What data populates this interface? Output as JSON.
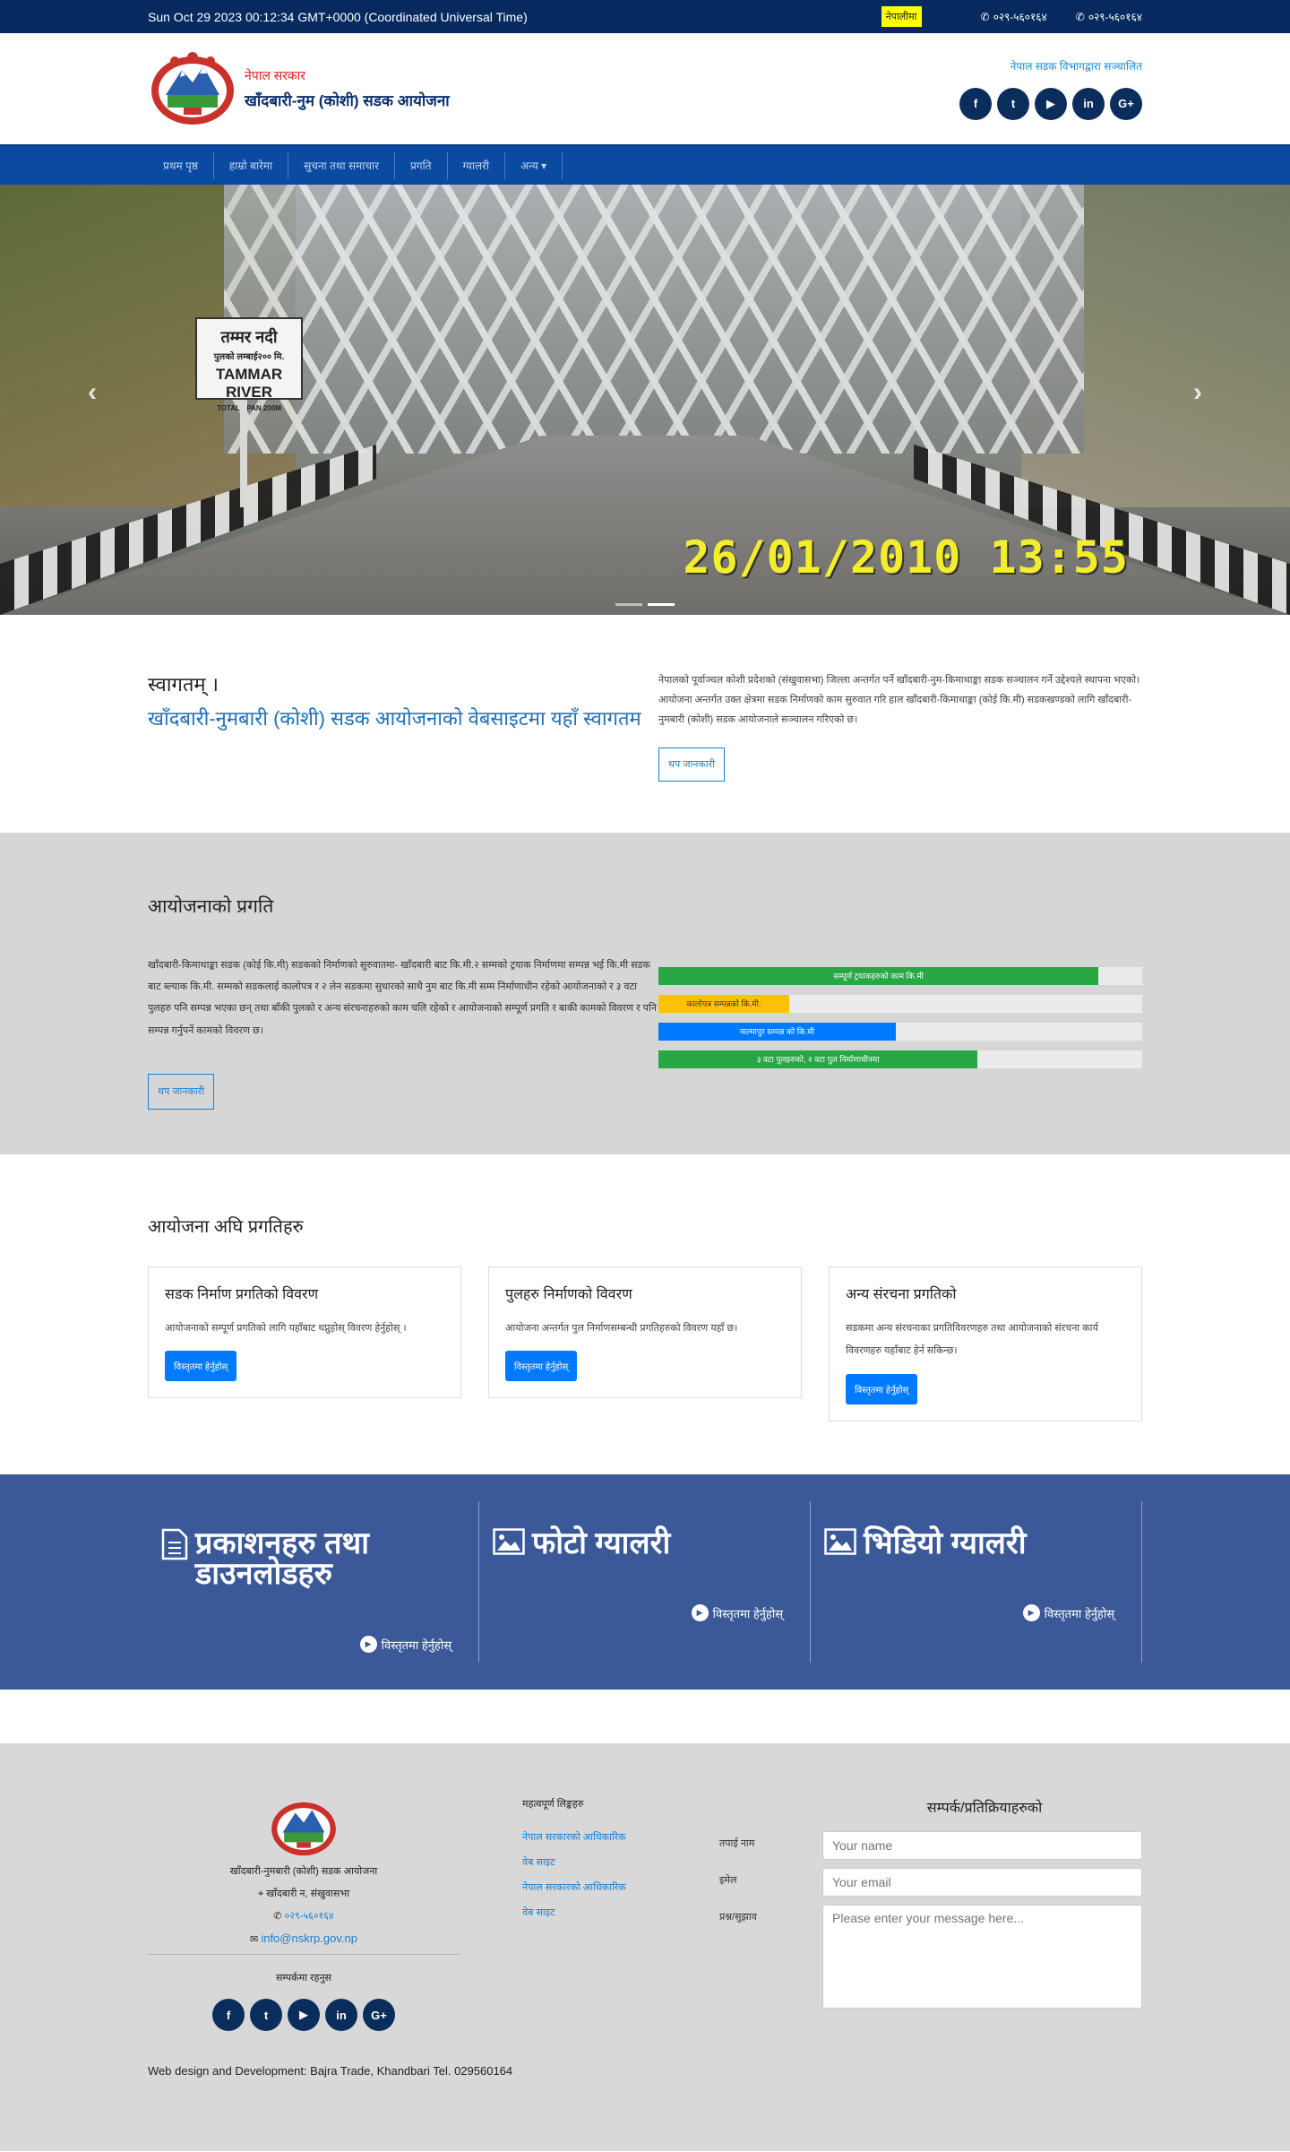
{
  "topbar": {
    "datetime": "Sun Oct 29 2023 00:12:34 GMT+0000 (Coordinated Universal Time)",
    "badge": "नेपालीमा",
    "phone1": "०२९-५६०१६४",
    "phone2": "०२९-५६०१६४"
  },
  "header": {
    "gov": "नेपाल सरकार",
    "office": "खाँदबारी-नुम (कोशी) सडक आयोजना",
    "info": "नेपाल सडक विभागद्वारा सञ्चालित",
    "socials": [
      "facebook-icon",
      "twitter-icon",
      "youtube-icon",
      "linkedin-icon",
      "google-plus-icon"
    ]
  },
  "nav": {
    "items": [
      "प्रथम पृष्ठ",
      "हाम्रो बारेमा",
      "सुचना तथा समाचार",
      "प्रगति",
      "ग्यालरी",
      "अन्य"
    ]
  },
  "slider": {
    "sign_l1": "तम्मर नदी",
    "sign_l2": "पुलको लम्बाई२०० मि.",
    "sign_l3": "TAMMAR RIVER",
    "sign_l4": "TOTAL SPAN 200M",
    "stamp": "26/01/2010  13:55",
    "prev": "‹",
    "next": "›"
  },
  "intro": {
    "small": "स्वागतम् ।",
    "title": "खाँदबारी-नुमबारी (कोशी) सडक आयोजनाको वेबसाइटमा यहाँ स्वागतम",
    "text": "नेपालको पूर्वाञ्चल कोशी प्रदेशको (संखुवासभा) जिल्ला अन्तर्गत पर्ने खाँदबारी-नुम-किमाथाङ्का सडक सञ्चालन गर्ने उद्देश्यले स्थापना भएको। आयोजना अन्तर्गत उक्त क्षेत्रमा सडक निर्माणको काम सुरुवात गरि हाल खाँदबारी-किमाथाङ्का (कोई कि.मी) सडकखण्डको लागि खाँदबारी-नुमबारी (कोशी) सडक आयोजनाले सञ्चालन गरिएको छ।",
    "button": "थप जानकारी"
  },
  "progress": {
    "heading": "आयोजनाको प्रगति",
    "text": "खाँदबारी-किमाथाङ्का सडक (कोई कि.मी) सडकको निर्माणको सुरुवातमा- खाँदबारी बाट कि.मी.२ सम्मको ट्रयाक निर्माणमा सम्पन्न भई कि.मी सडक बाट ब्ल्याक कि.मी. सम्मको सडकलाई कालोपत्र र २ लेन सडकमा सुधारको साथै नुम बाट कि.मी सम्म निर्माणाधीन रहेको आयोजनाको र ३ वटा पुलहरु पनि सम्पन्न भएका छन् तथा बाँकी पुलको र अन्य संरचनाहरुको काम चलि रहेको र आयोजनाको सम्पूर्ण प्रगति र बाकी कामको विवरण र पनि सम्पन्न गर्नुपर्ने कामको विवरण छ।",
    "bars": [
      {
        "label": "सम्पूर्ण ट्रयाकहरुको काम कि.मी",
        "percent": 91,
        "color": "green"
      },
      {
        "label": "कालोपत्र सम्पन्नको कि.मी.",
        "percent": 27,
        "color": "yellow"
      },
      {
        "label": "नाल्मापुर सम्पन्न को कि.मी",
        "percent": 49,
        "color": "blue"
      },
      {
        "label": "३ वटा पुलहरुको, २ वटा पुल निर्माणाधीनमा",
        "percent": 66,
        "color": "green"
      }
    ],
    "button": "थप जानकारी"
  },
  "projects": {
    "heading": "आयोजना अघि प्रगतिहरु",
    "cards": [
      {
        "title": "सडक निर्माण प्रगतिको विवरण",
        "text": "आयोजनाको सम्पूर्ण प्रगतिको लागि यहाँबाट थप्नुहोस् विवरण हेर्नुहोस् ।",
        "button": "विस्तृतमा हेर्नुहोस्"
      },
      {
        "title": "पुलहरु निर्माणको विवरण",
        "text": "आयोजना अन्तर्गत पुल निर्माणसम्बन्धी प्रगतिहरुको विवरण यहाँ छ।",
        "button": "विस्तृतमा हेर्नुहोस्"
      },
      {
        "title": "अन्य संरचना प्रगतिको",
        "text": "सडकमा अन्य संरचनाका प्रगतिविवरणहरु तथा आयोजनाको संरचना कार्य विवरणहरु यहाँबाट हेर्न सकिन्छ।",
        "button": "विस्तृतमा हेर्नुहोस्"
      }
    ]
  },
  "media": {
    "cols": [
      {
        "icon": "document-icon",
        "title": "प्रकाशनहरु तथा डाउनलोडहरु",
        "link": "विस्तृतमा हेर्नुहोस्"
      },
      {
        "icon": "image-icon",
        "title": "फोटो ग्यालरी",
        "link": "विस्तृतमा हेर्नुहोस्"
      },
      {
        "icon": "image-icon",
        "title": "भिडियो ग्यालरी",
        "link": "विस्तृतमा हेर्नुहोस्"
      }
    ]
  },
  "footer": {
    "office": "खाँदबारी-नुमबारी (कोशी) सडक आयोजना",
    "address": "खाँदबारी न, संखुवासभा",
    "phone": "०२९-५६०१६४",
    "email": "info@nskrp.gov.np",
    "follow": "सम्पर्कमा रहनुस",
    "links_head": "महत्वपूर्ण लिङ्कहरु",
    "links": [
      "नेपाल सरकारको आधिकारिक",
      "वेब साइट",
      "नेपाल सरकारको आधिकारिक",
      "वेब साइट"
    ],
    "contact_head": "सम्पर्क/प्रतिक्रियाहरुको",
    "name_label": "तपाई नाम",
    "email_label": "इमेल",
    "message_label": "प्रश्न/सुझाव",
    "name_placeholder": "Your name",
    "email_placeholder": "Your email",
    "message_placeholder": "Please enter your message here...",
    "credits": "Web design and Development: Bajra Trade, Khandbari Tel. 029560164"
  }
}
